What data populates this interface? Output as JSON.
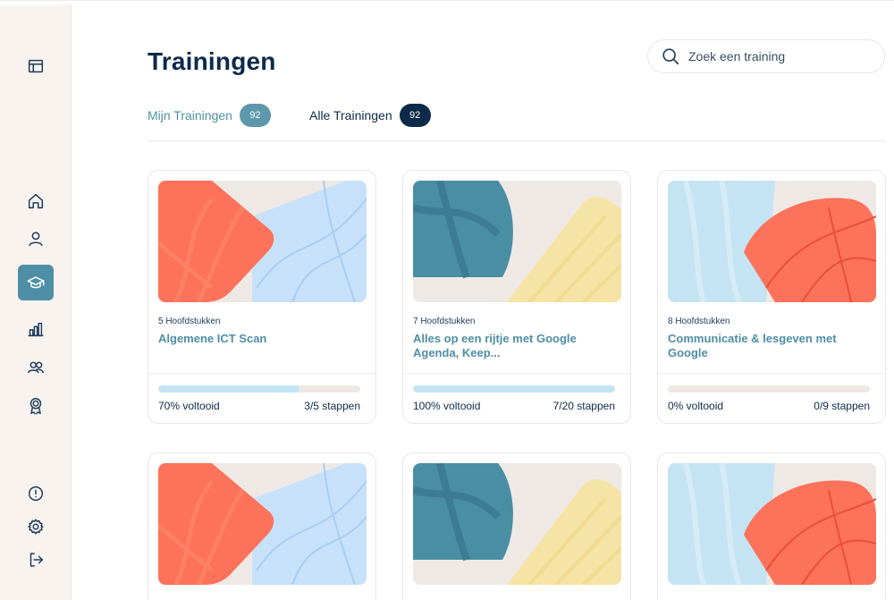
{
  "page": {
    "title": "Trainingen"
  },
  "search": {
    "placeholder": "Zoek een training"
  },
  "tabs": [
    {
      "label": "Mijn Trainingen",
      "count": "92"
    },
    {
      "label": "Alle Trainingen",
      "count": "92"
    }
  ],
  "sidebar": {
    "items": [
      {
        "icon": "layout-icon"
      },
      {
        "icon": "home-icon"
      },
      {
        "icon": "user-icon"
      },
      {
        "icon": "graduation-cap-icon",
        "active": true
      },
      {
        "icon": "bar-chart-icon"
      },
      {
        "icon": "users-icon"
      },
      {
        "icon": "award-icon"
      },
      {
        "icon": "info-icon"
      },
      {
        "icon": "settings-icon"
      },
      {
        "icon": "logout-icon"
      }
    ]
  },
  "colors": {
    "navy": "#0e2a4a",
    "teal": "#4e8fa6",
    "coral": "#fd725a",
    "light_blue": "#c5e4f3",
    "dark_teal": "#4a8ea3",
    "yellow": "#f6e4a6",
    "beige": "#efe9e5"
  },
  "cards": [
    {
      "chapters": "5 Hoofdstukken",
      "title": "Algemene ICT Scan",
      "progress": 0.7,
      "progress_label": "70% voltooid",
      "steps": "3/5 stappen"
    },
    {
      "chapters": "7 Hoofdstukken",
      "title": "Alles op een rijtje met Google Agenda, Keep...",
      "progress": 1.0,
      "progress_label": "100% voltooid",
      "steps": "7/20 stappen"
    },
    {
      "chapters": "8 Hoofdstukken",
      "title": "Communicatie & lesgeven met Google",
      "progress": 0.0,
      "progress_label": "0% voltooid",
      "steps": "0/9 stappen"
    },
    {
      "progress": null
    },
    {
      "progress": null
    },
    {
      "progress": null
    }
  ]
}
